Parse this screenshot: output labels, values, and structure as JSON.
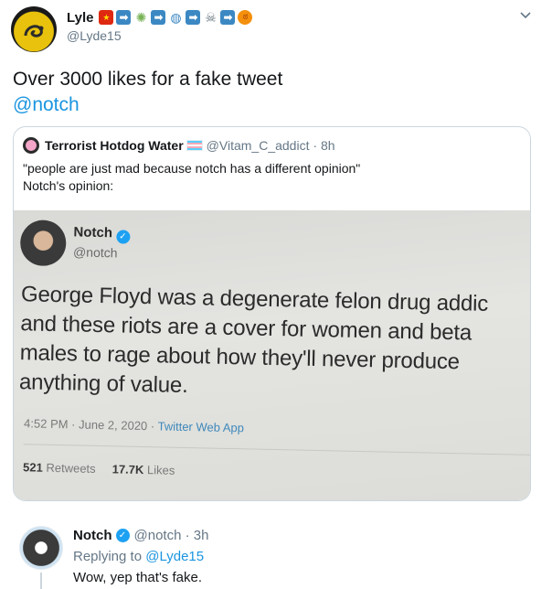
{
  "tweet": {
    "display_name": "Lyle",
    "handle": "@Lyde15",
    "name_emojis": [
      {
        "icon": "china-flag-icon",
        "glyph": "★"
      },
      {
        "icon": "right-arrow-icon",
        "glyph": "➡"
      },
      {
        "icon": "microbe-icon",
        "glyph": "✺"
      },
      {
        "icon": "right-arrow-icon",
        "glyph": "➡"
      },
      {
        "icon": "globe-icon",
        "glyph": "◍"
      },
      {
        "icon": "right-arrow-icon",
        "glyph": "➡"
      },
      {
        "icon": "skull-crossbones-icon",
        "glyph": "☠"
      },
      {
        "icon": "right-arrow-icon",
        "glyph": "➡"
      },
      {
        "icon": "angry-face-icon",
        "glyph": "ಠ"
      }
    ],
    "text": "Over 3000 likes for a fake tweet",
    "mention": "@notch"
  },
  "quote": {
    "display_name": "Terrorist Hotdog Water",
    "handle": "@Vitam_C_addict",
    "time": "· 8h",
    "text_line1": "\"people are just mad because notch has a different opinion\"",
    "text_line2": "Notch's opinion:",
    "photo": {
      "name": "Notch",
      "handle": "@notch",
      "lines": [
        "George Floyd was a degenerate felon drug addic",
        "and these riots are a cover for women and beta",
        "males to rage about how they'll never produce",
        "anything of value."
      ],
      "meta": "4:52 PM · June 2, 2020 · ",
      "app": "Twitter Web App",
      "retweets_count": "521",
      "retweets_label": "Retweets",
      "likes_count": "17.7K",
      "likes_label": "Likes"
    }
  },
  "reply": {
    "display_name": "Notch",
    "handle_time": "@notch · 3h",
    "replying_prefix": "Replying to",
    "replying_handle": "@Lyde15",
    "text": "Wow, yep that's fake."
  },
  "colors": {
    "link": "#1b95e0",
    "secondary_text": "#657786",
    "border": "#ccd6dd",
    "verified": "#1da1f2"
  }
}
